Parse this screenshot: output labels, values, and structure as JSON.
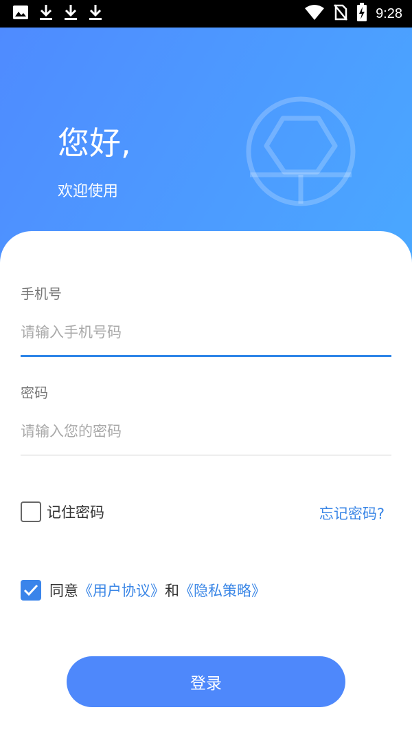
{
  "status_bar": {
    "time": "9:28",
    "left_icons": [
      "image-icon",
      "download-icon",
      "download-icon",
      "download-icon"
    ],
    "right_icons": [
      "wifi-icon",
      "no-sim-icon",
      "battery-charging-icon"
    ]
  },
  "header": {
    "greeting": "您好,",
    "welcome": "欢迎使用",
    "gradient_start": "#4f8bff",
    "gradient_end": "#4aa8ff"
  },
  "form": {
    "phone": {
      "label": "手机号",
      "placeholder": "请输入手机号码",
      "value": ""
    },
    "password": {
      "label": "密码",
      "placeholder": "请输入您的密码",
      "value": ""
    },
    "remember_label": "记住密码",
    "remember_checked": false,
    "forgot_label": "忘记密码?",
    "agree": {
      "checked": true,
      "prefix": "同意",
      "user_agreement": "《用户协议》",
      "conjunction": "和",
      "privacy_policy": "《隐私策略》"
    },
    "login_label": "登录"
  },
  "colors": {
    "accent": "#3a86e6",
    "button": "#4e88fb",
    "active_underline": "#2f86e8"
  }
}
